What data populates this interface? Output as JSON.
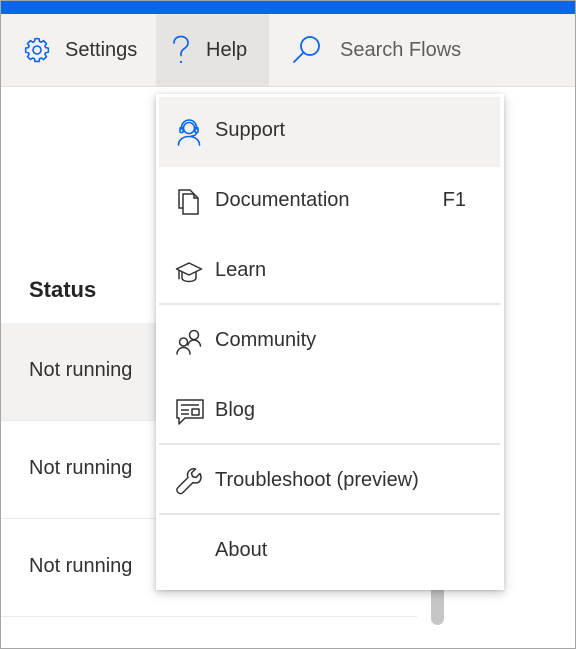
{
  "colors": {
    "accent": "#0a66e8",
    "toolbar_bg": "#f3f2f1",
    "hover_bg": "#f3f2f1"
  },
  "toolbar": {
    "settings_label": "Settings",
    "help_label": "Help",
    "search_placeholder": "Search Flows"
  },
  "table": {
    "status_header": "Status",
    "rows": [
      {
        "status": "Not running"
      },
      {
        "status": "Not running"
      },
      {
        "status": "Not running"
      }
    ]
  },
  "help_menu": {
    "items": [
      {
        "label": "Support",
        "icon": "headset-icon"
      },
      {
        "label": "Documentation",
        "icon": "documents-icon",
        "shortcut": "F1"
      },
      {
        "label": "Learn",
        "icon": "graduation-cap-icon"
      },
      {
        "label": "Community",
        "icon": "people-icon"
      },
      {
        "label": "Blog",
        "icon": "blog-icon"
      },
      {
        "label": "Troubleshoot (preview)",
        "icon": "wrench-icon"
      },
      {
        "label": "About",
        "icon": ""
      }
    ]
  }
}
